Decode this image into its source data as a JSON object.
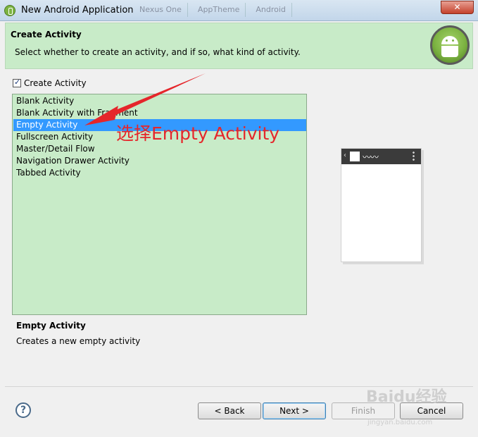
{
  "window": {
    "title": "New Android Application",
    "background_tabs": [
      "Nexus One",
      "AppTheme",
      "Android"
    ],
    "close_label": "✕"
  },
  "header": {
    "title": "Create Activity",
    "description": "Select whether to create an activity, and if so, what kind of activity."
  },
  "create_activity_checkbox": {
    "label": "Create Activity",
    "checked": true
  },
  "activity_list": {
    "items": [
      "Blank Activity",
      "Blank Activity with Fragment",
      "Empty Activity",
      "Fullscreen Activity",
      "Master/Detail Flow",
      "Navigation Drawer Activity",
      "Tabbed Activity"
    ],
    "selected_index": 2
  },
  "annotation": {
    "text": "选择Empty Activity",
    "color": "#e5262b"
  },
  "description": {
    "title": "Empty Activity",
    "text": "Creates a new empty activity"
  },
  "buttons": {
    "help": "?",
    "back": "< Back",
    "next": "Next >",
    "finish": "Finish",
    "cancel": "Cancel"
  },
  "watermark": {
    "text": "Baidu经验",
    "sub": "jingyan.baidu.com"
  },
  "colors": {
    "header_bg": "#c8ebc8",
    "selection": "#3399ff",
    "annotation": "#e5262b"
  }
}
